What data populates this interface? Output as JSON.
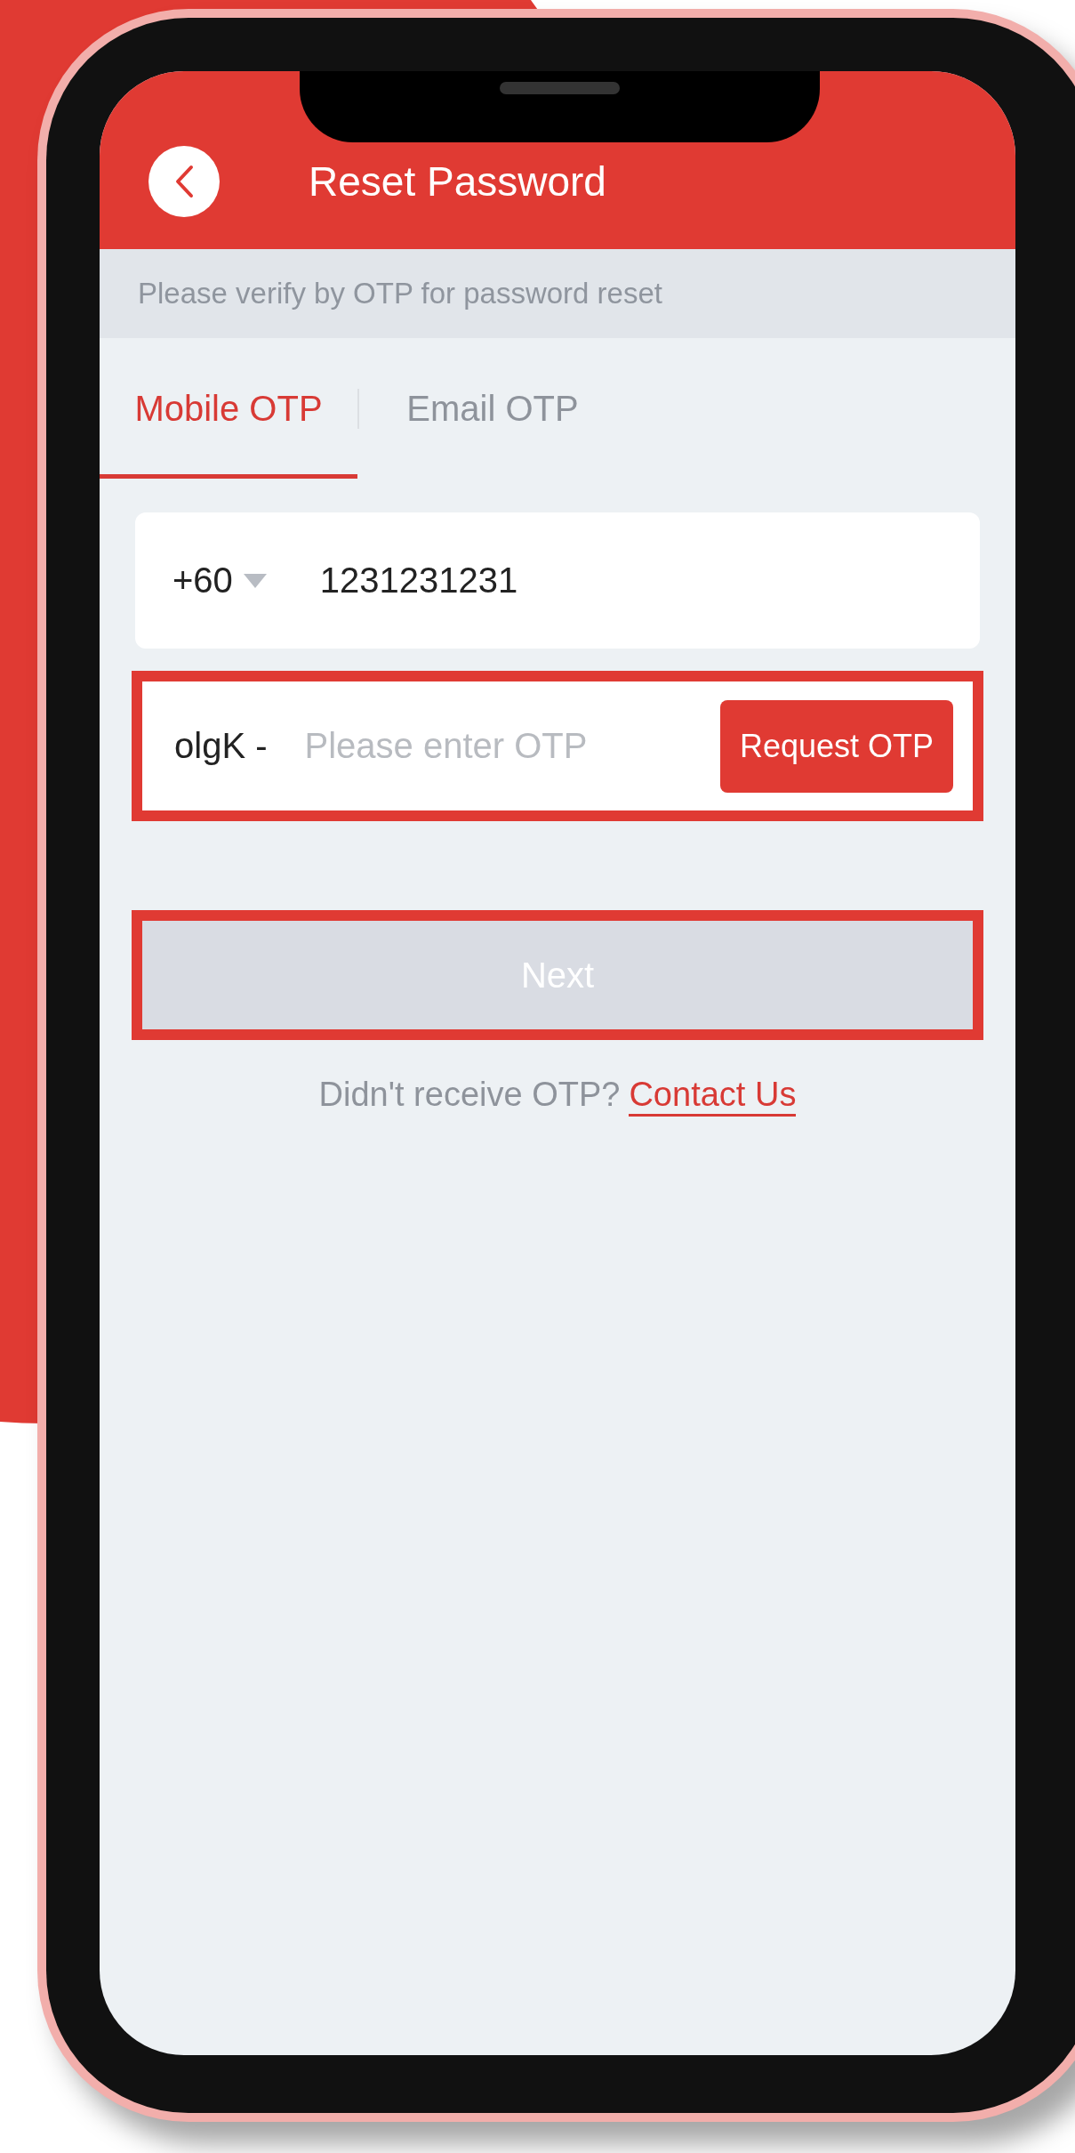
{
  "header": {
    "title": "Reset Password"
  },
  "notice": "Please verify by OTP for password reset",
  "tabs": [
    {
      "label": "Mobile OTP",
      "selected": true
    },
    {
      "label": "Email OTP",
      "selected": false
    }
  ],
  "phone": {
    "country_code": "+60",
    "value": "1231231231"
  },
  "otp": {
    "prefix": "olgK -",
    "placeholder": "Please enter OTP",
    "button": "Request OTP",
    "highlighted": true
  },
  "next": {
    "label": "Next",
    "disabled": true,
    "highlighted": true
  },
  "help": {
    "text": "Didn't receive OTP?",
    "link": "Contact Us"
  }
}
